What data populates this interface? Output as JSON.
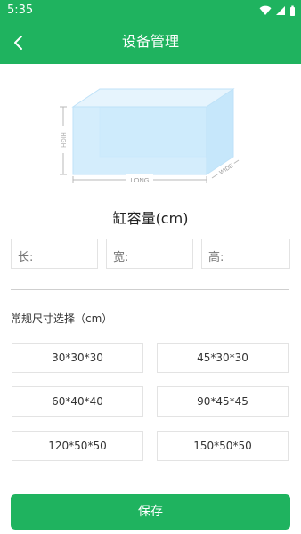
{
  "status": {
    "time": "5:35"
  },
  "header": {
    "title": "设备管理"
  },
  "tank_image": {
    "long_label": "LONG",
    "wide_label": "WIDE",
    "high_label": "HIGH"
  },
  "capacity": {
    "title": "缸容量(cm)"
  },
  "dimensions": {
    "length_label": "长:",
    "width_label": "宽:",
    "height_label": "高:",
    "length_value": "",
    "width_value": "",
    "height_value": ""
  },
  "presets": {
    "label": "常规尺寸选择（cm）",
    "options": [
      "30*30*30",
      "45*30*30",
      "60*40*40",
      "90*45*45",
      "120*50*50",
      "150*50*50"
    ]
  },
  "actions": {
    "save_label": "保存"
  },
  "colors": {
    "accent": "#1fb35f"
  }
}
